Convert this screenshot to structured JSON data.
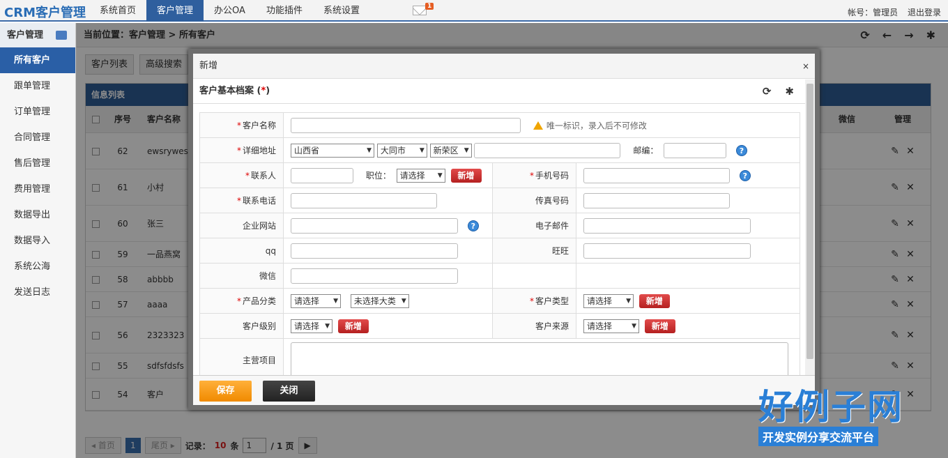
{
  "app": {
    "brand": "CRM客户管理"
  },
  "nav": [
    {
      "label": "系统首页"
    },
    {
      "label": "客户管理"
    },
    {
      "label": "办公OA"
    },
    {
      "label": "功能插件"
    },
    {
      "label": "系统设置"
    }
  ],
  "mail_badge": "1",
  "top_right": {
    "account": "帐号：管理员",
    "logout": "退出登录"
  },
  "sidebar": {
    "title": "客户管理",
    "items": [
      {
        "label": "所有客户"
      },
      {
        "label": "跟单管理"
      },
      {
        "label": "订单管理"
      },
      {
        "label": "合同管理"
      },
      {
        "label": "售后管理"
      },
      {
        "label": "费用管理"
      },
      {
        "label": "数据导出"
      },
      {
        "label": "数据导入"
      },
      {
        "label": "系统公海"
      },
      {
        "label": "发送日志"
      }
    ]
  },
  "breadcrumb": "当前位置：客户管理 > 所有客户",
  "subtabs": [
    "客户列表",
    "高级搜索"
  ],
  "grid": {
    "title": "信息列表",
    "headers": {
      "no": "序号",
      "name": "客户名称",
      "wechat": "微信",
      "manage": "管理"
    },
    "rows": [
      {
        "no": "62",
        "name": "ewsrywesrt"
      },
      {
        "no": "61",
        "name": "小村"
      },
      {
        "no": "60",
        "name": "张三"
      },
      {
        "no": "59",
        "name": "一品燕窝"
      },
      {
        "no": "58",
        "name": "abbbb"
      },
      {
        "no": "57",
        "name": "aaaa"
      },
      {
        "no": "56",
        "name": "2323323"
      },
      {
        "no": "55",
        "name": "sdfsfdsfs"
      },
      {
        "no": "54",
        "name": "客户"
      }
    ]
  },
  "pager": {
    "first": "首页",
    "page": "1",
    "last": "尾页",
    "records_label": "记录：",
    "records": "10",
    "unit": "条",
    "page_input": "1",
    "total": "/ 1 页"
  },
  "dialog": {
    "title": "新增",
    "close": "×",
    "section_title": "客户基本档案 (",
    "section_star": "*",
    "section_end": ")",
    "fields": {
      "name": "客户名称",
      "name_hint": "唯一标识，录入后不可修改",
      "address": "详细地址",
      "province": "山西省",
      "city": "大同市",
      "district": "新荣区",
      "postcode": "邮编：",
      "contact": "联系人",
      "position": "职位：",
      "position_sel": "请选择",
      "mobile": "手机号码",
      "phone": "联系电话",
      "fax": "传真号码",
      "website": "企业网站",
      "email": "电子邮件",
      "qq": "qq",
      "wangwang": "旺旺",
      "wechat": "微信",
      "product": "产品分类",
      "product_sel": "请选择",
      "product_sel2": "未选择大类",
      "ctype": "客户类型",
      "ctype_sel": "请选择",
      "level": "客户级别",
      "level_sel": "请选择",
      "source": "客户来源",
      "source_sel": "请选择",
      "business": "主营项目",
      "new_btn": "新增"
    },
    "save": "保存",
    "close_btn": "关闭"
  },
  "watermark": {
    "big": "好例子网",
    "small": "开发实例分享交流平台"
  }
}
